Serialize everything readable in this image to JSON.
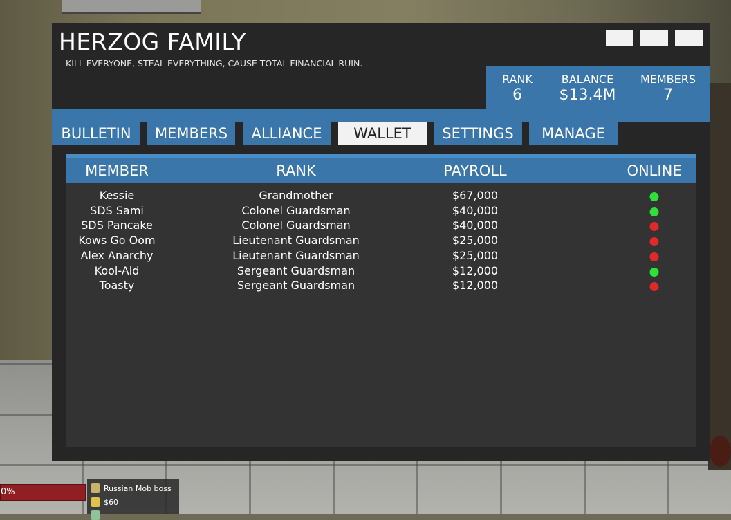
{
  "family": {
    "name": "HERZOG FAMILY",
    "motto": "KILL EVERYONE, STEAL EVERYTHING, CAUSE TOTAL FINANCIAL RUIN."
  },
  "stats": {
    "rank_label": "RANK",
    "rank_value": "6",
    "balance_label": "BALANCE",
    "balance_value": "$13.4M",
    "members_label": "MEMBERS",
    "members_value": "7"
  },
  "tabs": [
    "BULLETIN",
    "MEMBERS",
    "ALLIANCE",
    "WALLET",
    "SETTINGS",
    "MANAGE"
  ],
  "active_tab": "WALLET",
  "table": {
    "headers": [
      "MEMBER",
      "RANK",
      "PAYROLL",
      "ONLINE"
    ],
    "rows": [
      {
        "member": "Kessie",
        "rank": "Grandmother",
        "payroll": "$67,000",
        "online": true
      },
      {
        "member": "SDS Sami",
        "rank": "Colonel Guardsman",
        "payroll": "$40,000",
        "online": true
      },
      {
        "member": "SDS Pancake",
        "rank": "Colonel Guardsman",
        "payroll": "$40,000",
        "online": false
      },
      {
        "member": "Kows Go Oom",
        "rank": "Lieutenant Guardsman",
        "payroll": "$25,000",
        "online": false
      },
      {
        "member": "Alex Anarchy",
        "rank": "Lieutenant Guardsman",
        "payroll": "$25,000",
        "online": false
      },
      {
        "member": "Kool-Aid",
        "rank": "Sergeant Guardsman",
        "payroll": "$12,000",
        "online": true
      },
      {
        "member": "Toasty",
        "rank": "Sergeant Guardsman",
        "payroll": "$12,000",
        "online": false
      }
    ]
  },
  "colors": {
    "accent": "#3a76aa",
    "online": "#2ee03a",
    "offline": "#e02a2a"
  },
  "hud": {
    "health_text": "0%",
    "job": "Russian Mob boss",
    "money": "$60"
  }
}
